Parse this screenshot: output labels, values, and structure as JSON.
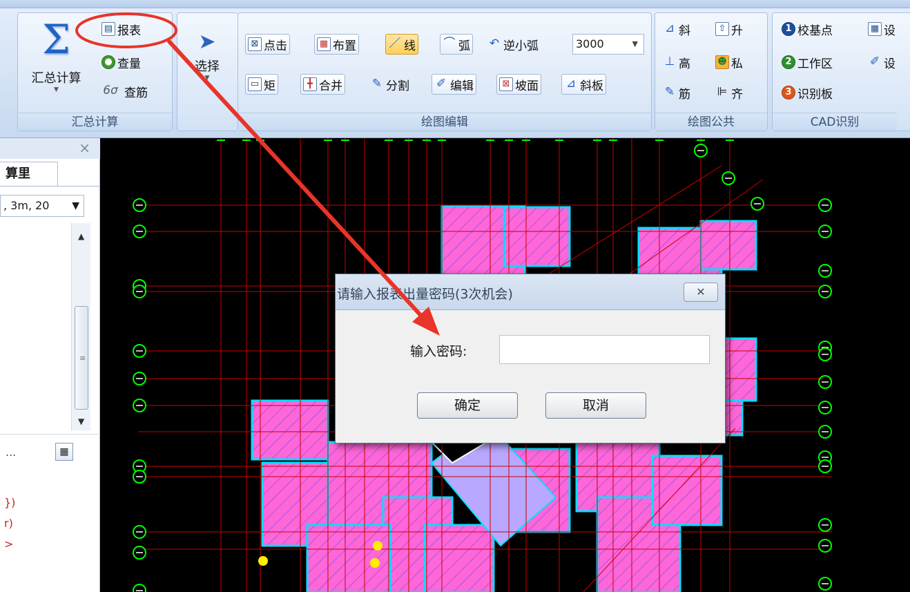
{
  "ribbon": {
    "summary_group": {
      "label": "汇总计算",
      "big_button": "汇总计算",
      "report": "报表",
      "check_qty": "查量",
      "check_rebar": "查筋"
    },
    "select_group": {
      "select": "选择"
    },
    "draw_edit_group": {
      "label": "绘图编辑",
      "point": "点击",
      "place": "布置",
      "line": "线",
      "arc": "弧",
      "ccw_arc": "逆小弧",
      "arc_value": "3000",
      "rect": "矩",
      "merge": "合并",
      "split": "分割",
      "edit": "编辑",
      "slope_face": "坡面",
      "slope_slab": "斜板"
    },
    "draw_common_group": {
      "label": "绘图公共",
      "slope": "斜",
      "raise": "升",
      "height": "高",
      "private": "私",
      "rebar": "筋",
      "align": "齐"
    },
    "cad_group": {
      "label": "CAD识别",
      "calibrate_point": "校基点",
      "work_area": "工作区",
      "identify_slab": "识别板",
      "num1": "1",
      "num2": "2",
      "num3": "3",
      "cut1": "设",
      "cut2": "设"
    }
  },
  "left_pane": {
    "close": "×",
    "tab": "算里",
    "combo_value": ", 3m, 20",
    "filter_text": "...",
    "red_lines": [
      "})",
      "r)",
      ">"
    ]
  },
  "dialog": {
    "title": "请输入报表出量密码(3次机会)",
    "close_glyph": "✕",
    "password_label": "输入密码:",
    "password_value": "",
    "ok": "确定",
    "cancel": "取消"
  },
  "colors": {
    "ribbon_bg": "#d3e2f5",
    "cad_bg": "#000000",
    "cad_room_fill": "#ff66d8",
    "cad_grid": "#cc0000",
    "cad_wall": "#00e0ff",
    "axis_bubble": "#00ff00",
    "annotation_red": "#e8342a"
  }
}
